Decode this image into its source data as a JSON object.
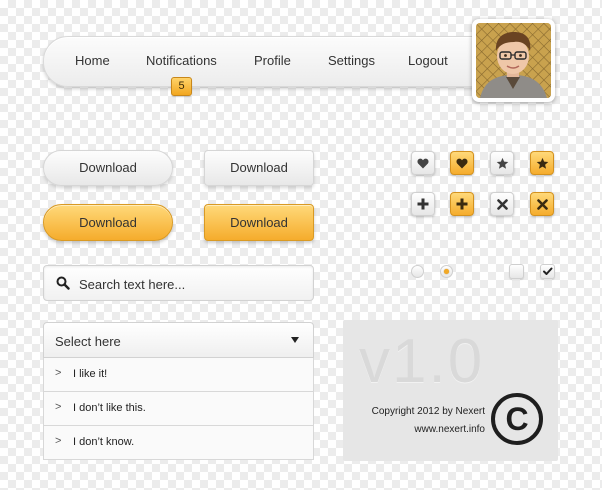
{
  "nav": {
    "items": [
      {
        "label": "Home"
      },
      {
        "label": "Notifications"
      },
      {
        "label": "Profile"
      },
      {
        "label": "Settings"
      },
      {
        "label": "Logout"
      }
    ],
    "notification_badge": "5"
  },
  "buttons": {
    "download_1": "Download",
    "download_2": "Download",
    "download_3": "Download",
    "download_4": "Download"
  },
  "icon_buttons": {
    "row1": [
      "heart-icon",
      "heart-icon",
      "star-icon",
      "star-icon"
    ],
    "row2": [
      "plus-icon",
      "plus-icon",
      "close-icon",
      "close-icon"
    ]
  },
  "controls": {
    "radio_1_checked": false,
    "radio_2_checked": true,
    "checkbox_1_checked": false,
    "checkbox_2_checked": true
  },
  "search": {
    "placeholder": "Search text here..."
  },
  "select": {
    "label": "Select here",
    "options": [
      {
        "chevron": ">",
        "label": "I like it!"
      },
      {
        "chevron": ">",
        "label": "I don’t like this."
      },
      {
        "chevron": ">",
        "label": "I don’t know."
      }
    ]
  },
  "card": {
    "version": "v1.0",
    "copyright": "Copyright 2012 by Nexert",
    "website": "www.nexert.info",
    "symbol": "©"
  },
  "colors": {
    "accent_yellow": "#f5ac2c",
    "accent_yellow_light": "#ffd97a",
    "text_dark": "#333333"
  }
}
